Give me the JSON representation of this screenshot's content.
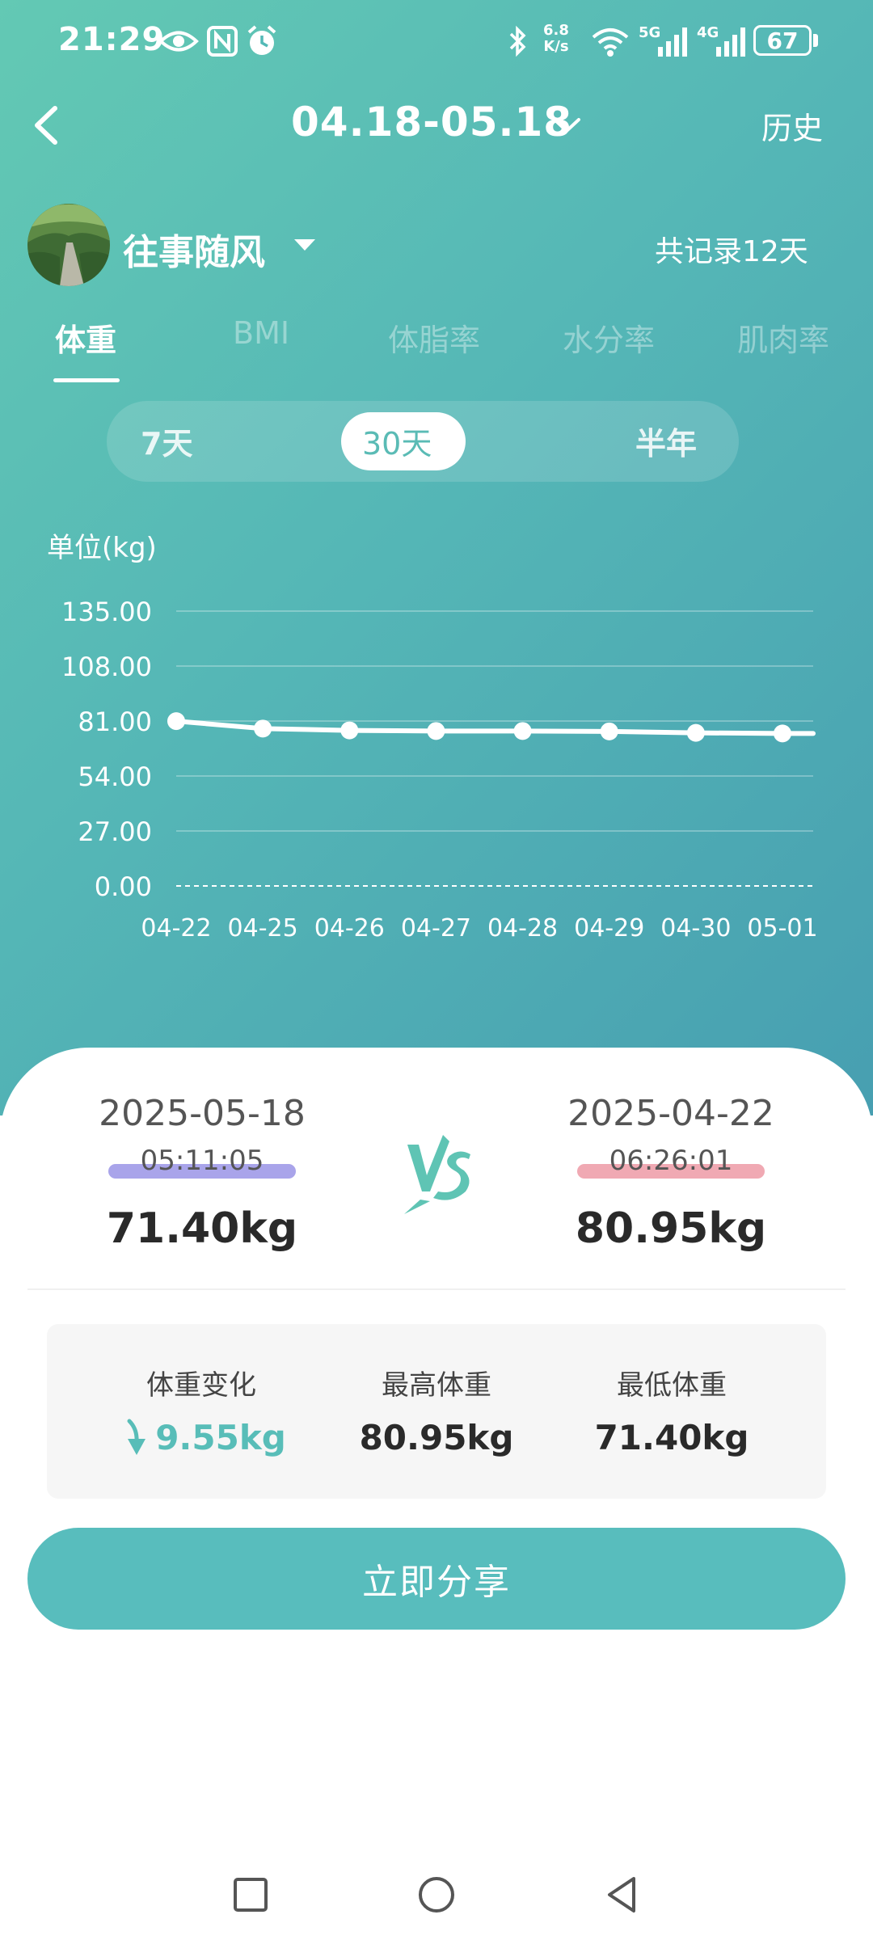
{
  "status_bar": {
    "time": "21:29",
    "net_speed_value": "6.8",
    "net_speed_unit": "K/s",
    "sig1_label": "5G",
    "sig2_label": "4G",
    "battery": "67",
    "icons": [
      "eye-icon",
      "nfc-icon",
      "alarm-icon",
      "bluetooth-icon",
      "wifi-icon",
      "signal-icon",
      "signal-icon",
      "battery-icon"
    ]
  },
  "header": {
    "date_range": "04.18-05.18",
    "history_label": "历史"
  },
  "user": {
    "name": "往事随风",
    "record_count": "共记录12天"
  },
  "metric_tabs": [
    {
      "label": "体重",
      "active": true
    },
    {
      "label": "BMI",
      "active": false
    },
    {
      "label": "体脂率",
      "active": false
    },
    {
      "label": "水分率",
      "active": false
    },
    {
      "label": "肌肉率",
      "active": false
    }
  ],
  "period_tabs": [
    {
      "label": "7天",
      "active": false
    },
    {
      "label": "30天",
      "active": true
    },
    {
      "label": "半年",
      "active": false
    }
  ],
  "chart_data": {
    "type": "line",
    "ylabel": "单位(kg)",
    "ylim": [
      0,
      135
    ],
    "y_ticks": [
      "135.00",
      "108.00",
      "81.00",
      "54.00",
      "27.00",
      "0.00"
    ],
    "y_tick_values": [
      135,
      108,
      81,
      54,
      27,
      0
    ],
    "categories": [
      "04-22",
      "04-25",
      "04-26",
      "04-27",
      "04-28",
      "04-29",
      "04-30",
      "05-01"
    ],
    "series": [
      {
        "values": [
          80.95,
          77.3,
          76.4,
          76.1,
          76.1,
          75.9,
          75.2,
          74.9
        ],
        "color": "#ffffff"
      }
    ],
    "grid": true
  },
  "comparison": {
    "left": {
      "date": "2025-05-18",
      "time": "05:11:05",
      "weight": "71.40kg",
      "highlight": "#a9a4ea"
    },
    "vs_label": "VS",
    "right": {
      "date": "2025-04-22",
      "time": "06:26:01",
      "weight": "80.95kg",
      "highlight": "#f0a9b3"
    }
  },
  "stats": {
    "change_label": "体重变化",
    "change_value": "9.55kg",
    "change_direction": "down",
    "max_label": "最高体重",
    "max_value": "80.95kg",
    "min_label": "最低体重",
    "min_value": "71.40kg"
  },
  "share_label": "立即分享",
  "colors": {
    "accent": "#58bdbd",
    "gradient_start": "#63c9b4",
    "gradient_end": "#479fb1"
  }
}
